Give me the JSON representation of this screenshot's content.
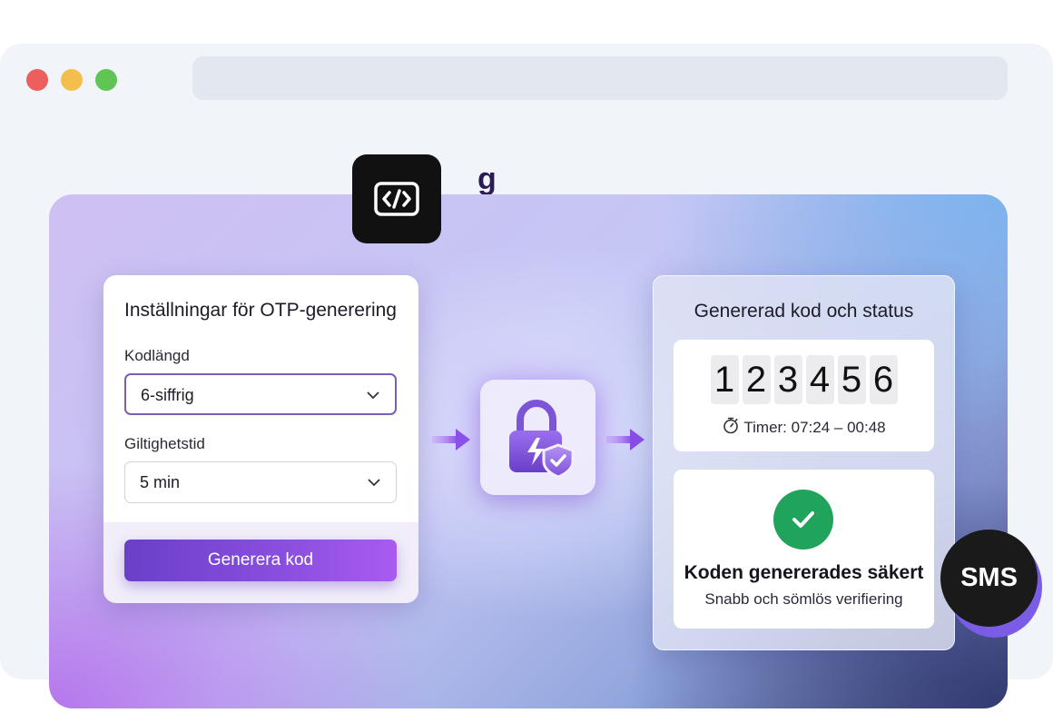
{
  "window": {
    "controls": [
      "close",
      "minimize",
      "maximize"
    ],
    "address_bar": ""
  },
  "header": {
    "title_fragment": "g"
  },
  "settings_panel": {
    "title": "Inställningar för OTP-generering",
    "code_length": {
      "label": "Kodlängd",
      "value": "6-siffrig"
    },
    "validity": {
      "label": "Giltighetstid",
      "value": "5 min"
    },
    "generate_button": "Generera kod"
  },
  "result_panel": {
    "title": "Genererad kod och status",
    "code_digits": [
      "1",
      "2",
      "3",
      "4",
      "5",
      "6"
    ],
    "timer": "Timer: 07:24 – 00:48",
    "status_title": "Koden genererades säkert",
    "status_subtitle": "Snabb och sömlös verifiering"
  },
  "badges": {
    "sms": "SMS",
    "code_icon": "code-brackets-icon"
  },
  "colors": {
    "accent": "#7b4fd8",
    "success": "#20a35a",
    "dark": "#111111"
  }
}
